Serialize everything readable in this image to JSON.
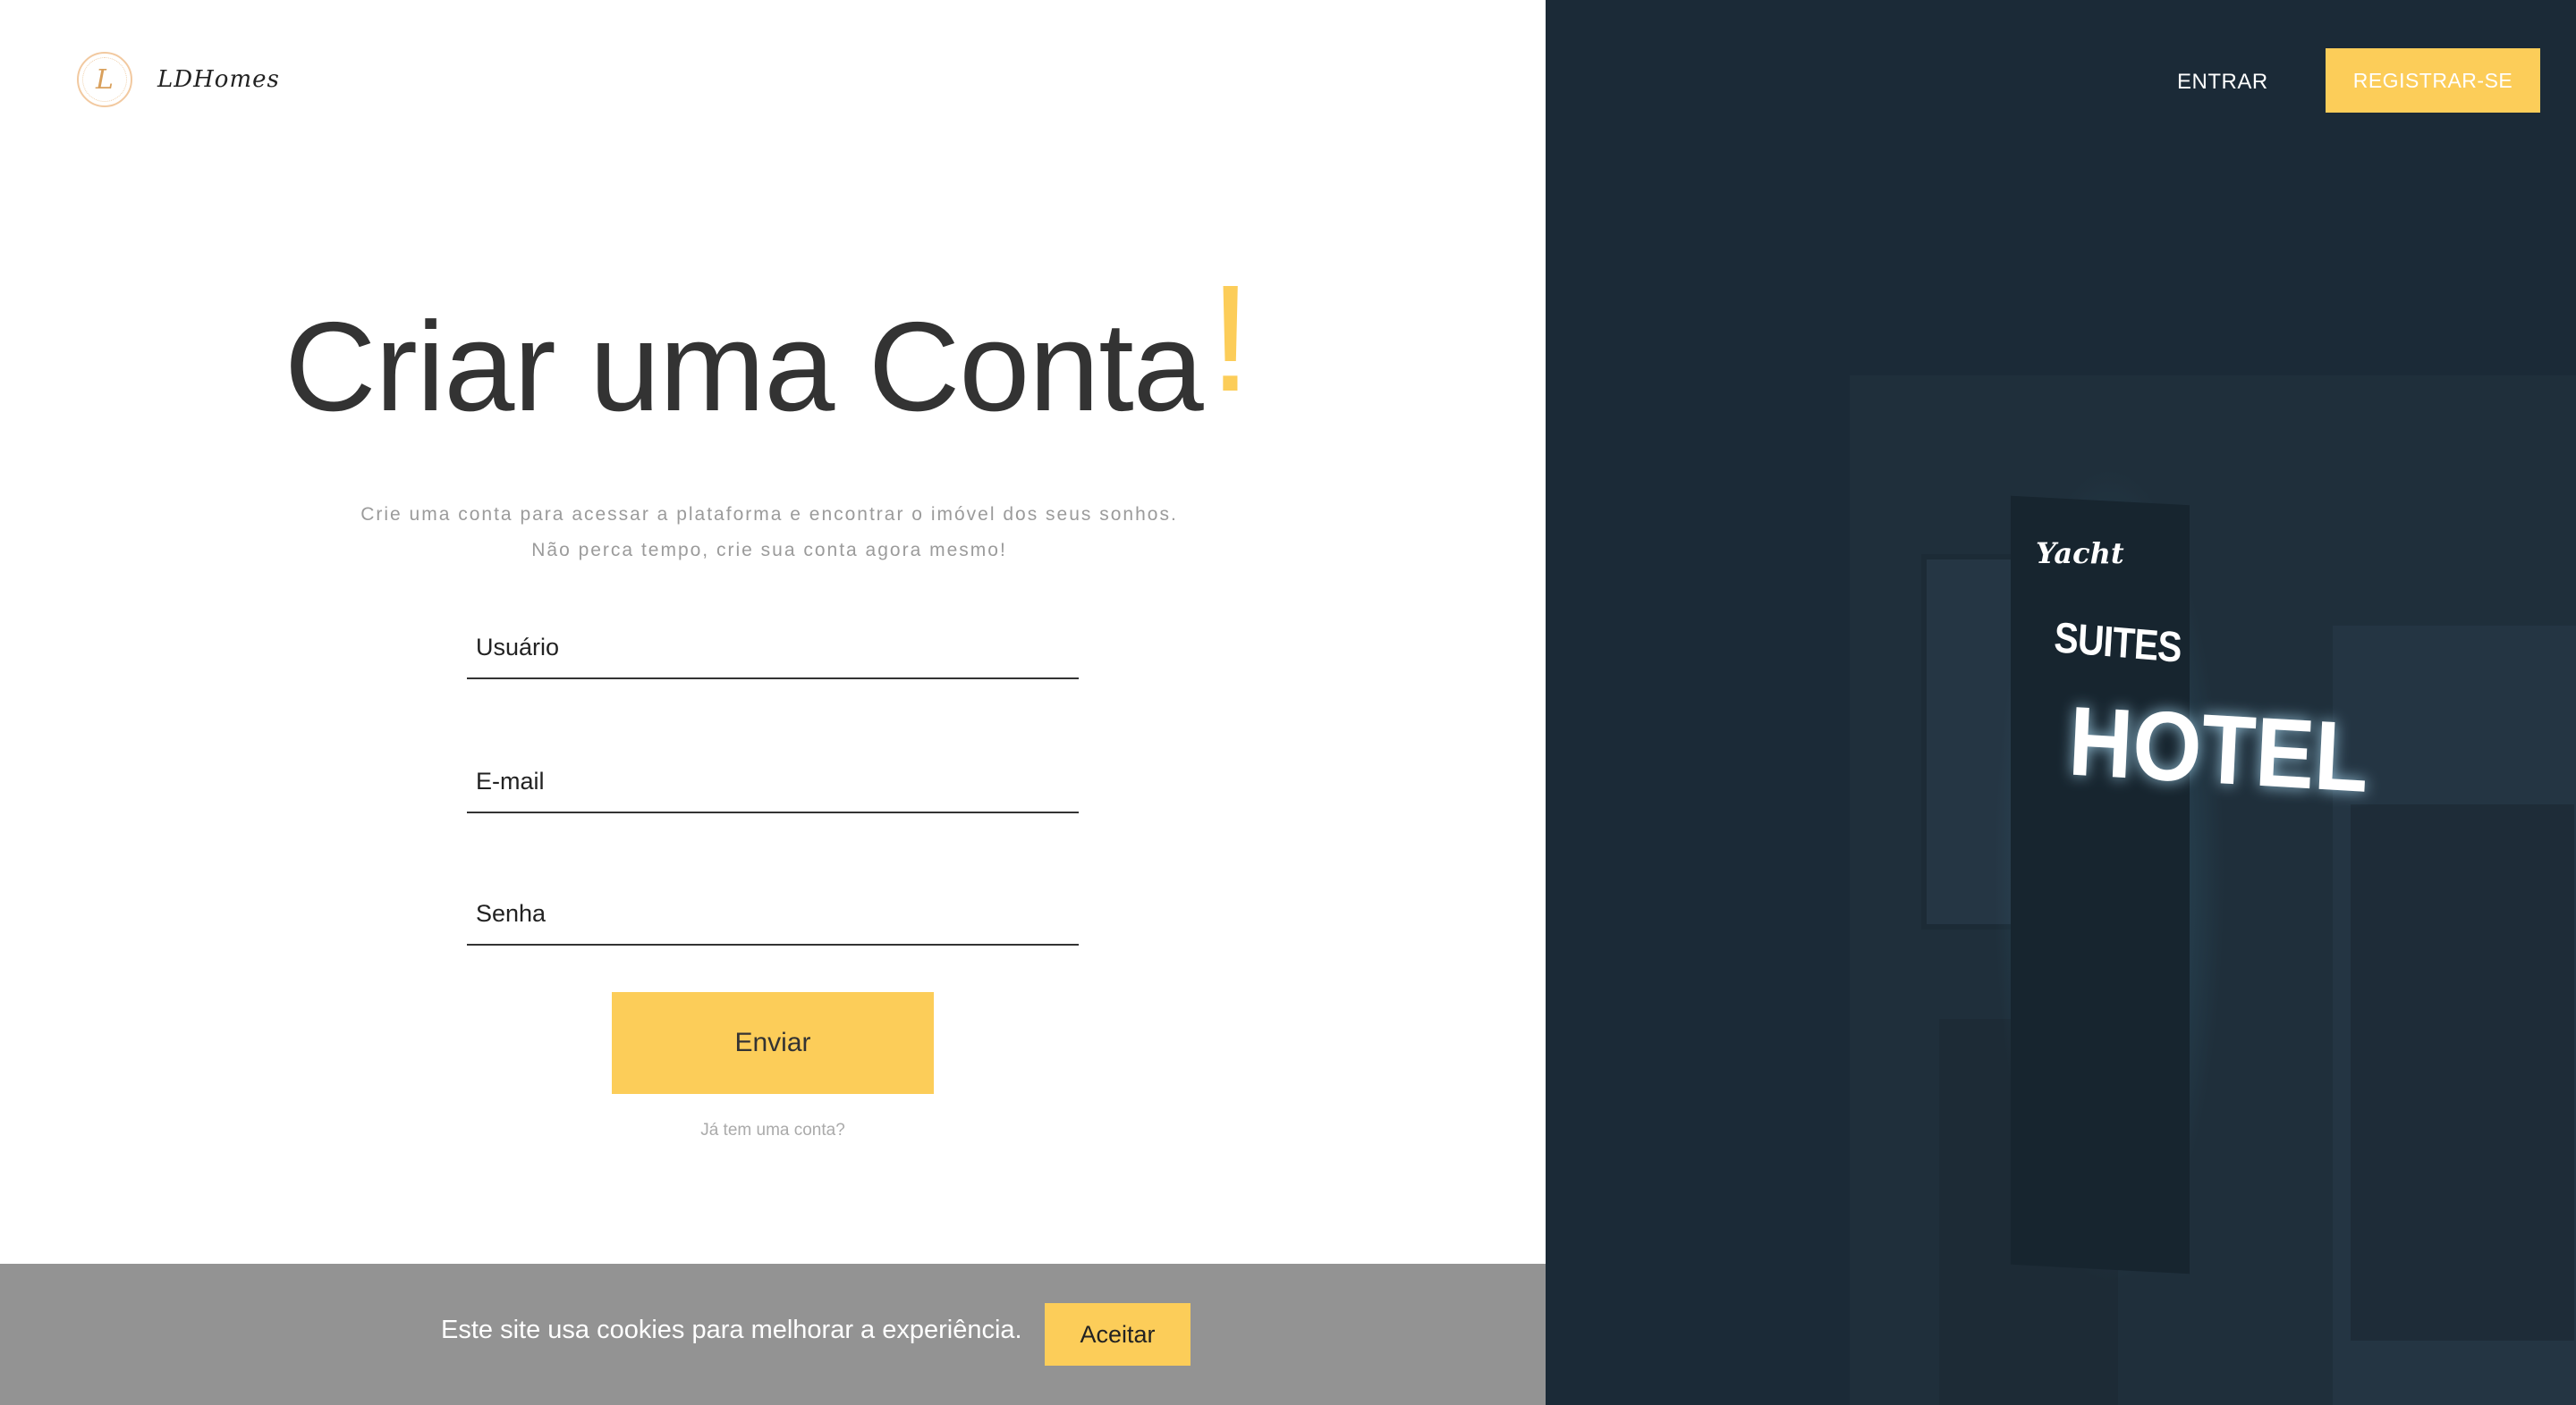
{
  "brand": {
    "logo_letter": "L",
    "name": "LDHomes"
  },
  "nav": {
    "login_label": "ENTRAR",
    "register_label": "REGISTRAR-SE"
  },
  "main": {
    "title": "Criar uma Conta",
    "title_accent": "!",
    "subtitle": "Crie uma conta para acessar a plataforma e encontrar o imóvel dos seus sonhos. Não perca tempo, crie sua conta agora mesmo!",
    "fields": [
      {
        "label": "Usuário"
      },
      {
        "label": "E-mail"
      },
      {
        "label": "Senha"
      }
    ],
    "submit_label": "Enviar",
    "have_account_link": "Já tem uma conta?"
  },
  "cookie": {
    "text": "Este site usa cookies para melhorar a experiência.",
    "accept_label": "Aceitar"
  },
  "photo": {
    "sign_top": "Yacht",
    "sign_middle": "SUITES",
    "sign_main": "HOTEL"
  },
  "colors": {
    "accent": "#fccd59",
    "dark_panel": "#1b2a37",
    "cookie_bg": "#939393",
    "text_dark": "#333333"
  }
}
